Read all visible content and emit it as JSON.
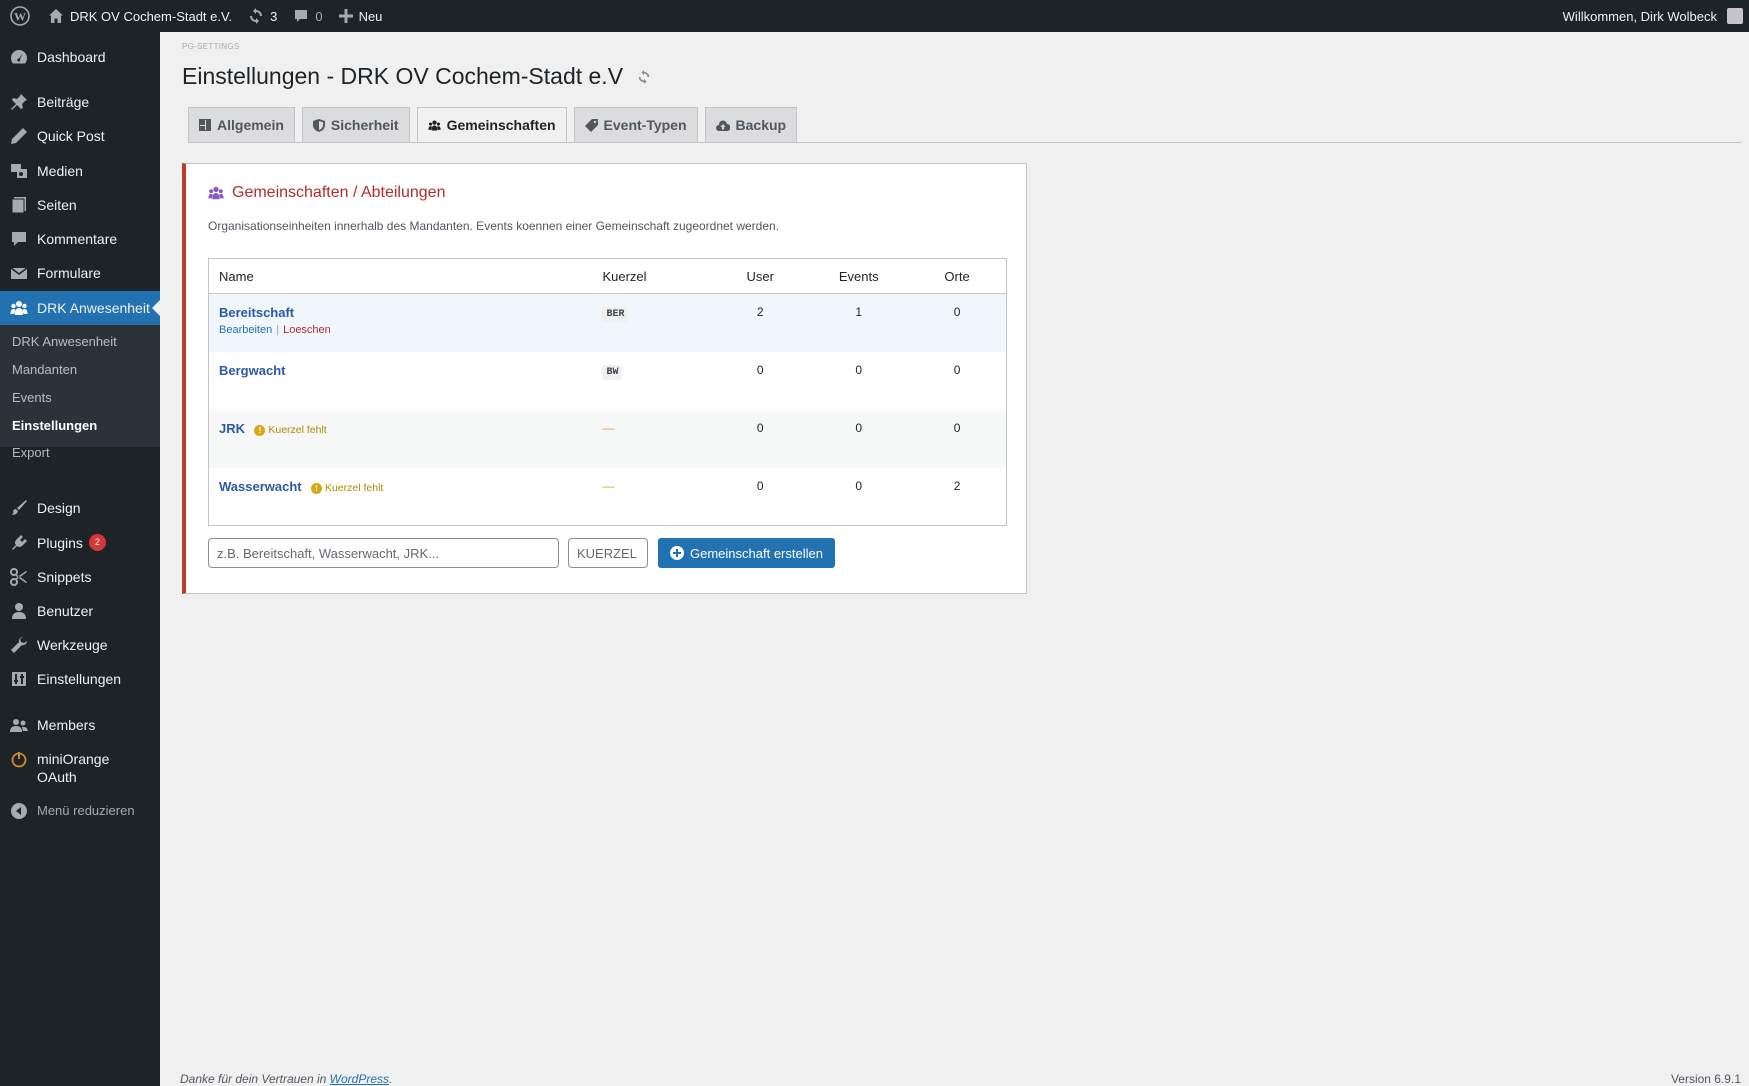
{
  "adminbar": {
    "site_name": "DRK OV Cochem-Stadt e.V.",
    "updates_count": "3",
    "comments_count": "0",
    "new_label": "Neu",
    "greeting": "Willkommen, Dirk Wolbeck"
  },
  "sidebar": {
    "items": [
      {
        "label": "Dashboard",
        "icon": "dashboard-icon"
      },
      {
        "label": "Beiträge",
        "icon": "pin-icon"
      },
      {
        "label": "Quick Post",
        "icon": "pencil-icon"
      },
      {
        "label": "Medien",
        "icon": "media-icon"
      },
      {
        "label": "Seiten",
        "icon": "pages-icon"
      },
      {
        "label": "Kommentare",
        "icon": "comment-icon"
      },
      {
        "label": "Formulare",
        "icon": "mail-icon"
      },
      {
        "label": "DRK Anwesenheit",
        "icon": "groups-icon"
      },
      {
        "label": "Design",
        "icon": "brush-icon"
      },
      {
        "label": "Plugins",
        "icon": "plugin-icon",
        "badge": "2"
      },
      {
        "label": "Snippets",
        "icon": "scissors-icon"
      },
      {
        "label": "Benutzer",
        "icon": "user-icon"
      },
      {
        "label": "Werkzeuge",
        "icon": "wrench-icon"
      },
      {
        "label": "Einstellungen",
        "icon": "settings-icon"
      },
      {
        "label": "Members",
        "icon": "members-icon"
      },
      {
        "label": "miniOrange OAuth",
        "icon": "power-icon"
      }
    ],
    "submenu": [
      "DRK Anwesenheit",
      "Mandanten",
      "Events",
      "Einstellungen",
      "Export"
    ],
    "collapse_label": "Menü reduzieren"
  },
  "page": {
    "eyebrow": "PG-SETTINGS",
    "title": "Einstellungen - DRK OV Cochem-Stadt e.V"
  },
  "tabs": [
    "Allgemein",
    "Sicherheit",
    "Gemeinschaften",
    "Event-Typen",
    "Backup"
  ],
  "card": {
    "title": "Gemeinschaften / Abteilungen",
    "description": "Organisationseinheiten innerhalb des Mandanten. Events koennen einer Gemeinschaft zugeordnet werden."
  },
  "table": {
    "headers": [
      "Name",
      "Kuerzel",
      "User",
      "Events",
      "Orte"
    ],
    "rows": [
      {
        "name": "Bereitschaft",
        "kuerzel": "BER",
        "user": "2",
        "events": "1",
        "orte": "0",
        "actions": [
          "Bearbeiten",
          "Loeschen"
        ]
      },
      {
        "name": "Bergwacht",
        "kuerzel": "BW",
        "user": "0",
        "events": "0",
        "orte": "0"
      },
      {
        "name": "JRK",
        "kuerzel": "—",
        "warning": "Kuerzel fehlt",
        "user": "0",
        "events": "0",
        "orte": "0"
      },
      {
        "name": "Wasserwacht",
        "kuerzel": "—",
        "warning": "Kuerzel fehlt",
        "user": "0",
        "events": "0",
        "orte": "2"
      }
    ]
  },
  "form": {
    "name_placeholder": "z.B. Bereitschaft, Wasserwacht, JRK...",
    "kuerzel_placeholder": "KUERZEL",
    "create_label": "Gemeinschaft erstellen"
  },
  "footer": {
    "thanks_prefix": "Danke für dein Vertrauen in ",
    "wordpress_link": "WordPress",
    "thanks_suffix": ".",
    "version": "Version 6.9.1"
  }
}
